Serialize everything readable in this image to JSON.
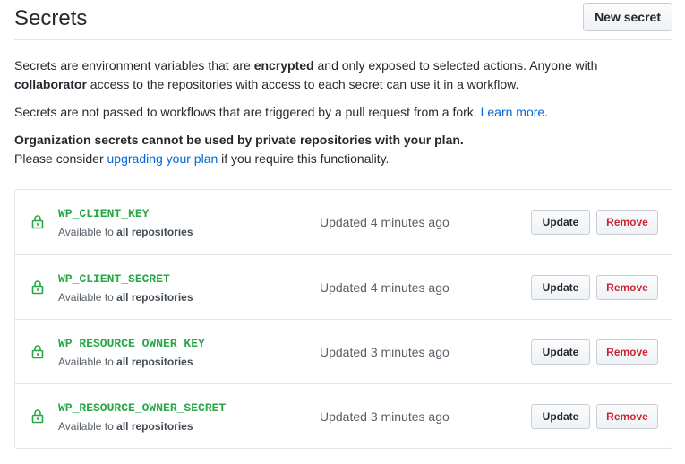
{
  "header": {
    "title": "Secrets",
    "new_secret_label": "New secret"
  },
  "description": {
    "p1_a": "Secrets are environment variables that are ",
    "p1_b": "encrypted",
    "p1_c": " and only exposed to selected actions. Anyone with ",
    "p1_d": "collaborator",
    "p1_e": " access to the repositories with access to each secret can use it in a workflow.",
    "p2_a": "Secrets are not passed to workflows that are triggered by a pull request from a fork. ",
    "p2_link": "Learn more",
    "p2_b": ".",
    "p3_bold": "Organization secrets cannot be used by private repositories with your plan.",
    "p3_a": "Please consider ",
    "p3_link": "upgrading your plan",
    "p3_b": " if you require this functionality."
  },
  "secrets": [
    {
      "name": "WP_CLIENT_KEY",
      "scope_prefix": "Available to ",
      "scope_bold": "all repositories",
      "updated": "Updated 4 minutes ago",
      "update_label": "Update",
      "remove_label": "Remove"
    },
    {
      "name": "WP_CLIENT_SECRET",
      "scope_prefix": "Available to ",
      "scope_bold": "all repositories",
      "updated": "Updated 4 minutes ago",
      "update_label": "Update",
      "remove_label": "Remove"
    },
    {
      "name": "WP_RESOURCE_OWNER_KEY",
      "scope_prefix": "Available to ",
      "scope_bold": "all repositories",
      "updated": "Updated 3 minutes ago",
      "update_label": "Update",
      "remove_label": "Remove"
    },
    {
      "name": "WP_RESOURCE_OWNER_SECRET",
      "scope_prefix": "Available to ",
      "scope_bold": "all repositories",
      "updated": "Updated 3 minutes ago",
      "update_label": "Update",
      "remove_label": "Remove"
    }
  ],
  "colors": {
    "secret_name": "#28a745",
    "link": "#0366d6",
    "remove": "#cb2431",
    "border": "#e1e4e8"
  },
  "icons": {
    "row_icon": "lock-icon"
  }
}
